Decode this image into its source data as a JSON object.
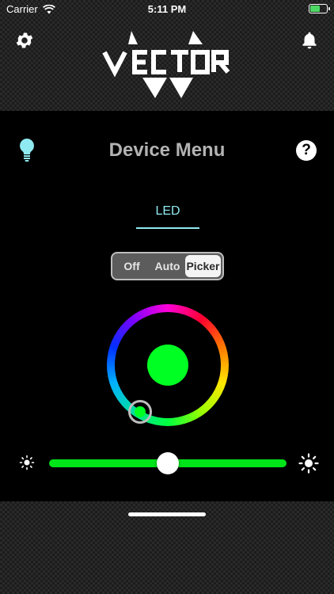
{
  "status_bar": {
    "carrier": "Carrier",
    "time": "5:11 PM",
    "battery_level": 0.6
  },
  "header": {
    "logo_text": "VECTOR",
    "left_icon": "gear-icon",
    "right_icon": "bell-icon"
  },
  "panel": {
    "title": "Device Menu",
    "left_icon": "lightbulb-icon",
    "help_label": "?"
  },
  "tabs": [
    {
      "label": "LED",
      "active": true
    }
  ],
  "mode_control": {
    "options": [
      "Off",
      "Auto",
      "Picker"
    ],
    "selected": "Picker"
  },
  "color_picker": {
    "selected_color": "#00ff22"
  },
  "brightness": {
    "value_fraction": 0.5,
    "track_color": "#00e41a"
  },
  "colors": {
    "accent": "#8fe9f0",
    "title_gray": "#b3b3b3"
  }
}
